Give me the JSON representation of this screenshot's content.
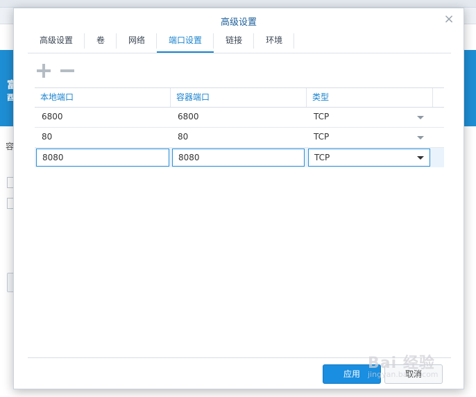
{
  "dialog": {
    "title": "高级设置",
    "close_glyph": "×"
  },
  "tabs": [
    {
      "label": "高级设置",
      "active": false
    },
    {
      "label": "卷",
      "active": false
    },
    {
      "label": "网络",
      "active": false
    },
    {
      "label": "端口设置",
      "active": true
    },
    {
      "label": "链接",
      "active": false
    },
    {
      "label": "环境",
      "active": false
    }
  ],
  "toolbar": {
    "add_icon": "plus-icon",
    "remove_icon": "minus-icon"
  },
  "table": {
    "columns": [
      "本地端口",
      "容器端口",
      "类型"
    ],
    "rows": [
      {
        "local": "6800",
        "container": "6800",
        "type": "TCP"
      },
      {
        "local": "80",
        "container": "80",
        "type": "TCP"
      },
      {
        "local": "8080",
        "container": "8080",
        "type": "TCP",
        "editing": true
      }
    ]
  },
  "buttons": {
    "apply": "应用",
    "cancel": "取消"
  },
  "background": {
    "glyph_a": "富",
    "glyph_b": "酉",
    "glyph_c": "容"
  },
  "watermark": {
    "main": "Bai 经验",
    "sub": "jingyan.baidu.com"
  },
  "colors": {
    "accent": "#1b84cf",
    "primary_button": "#1a8ee0",
    "background_band": "#1e8ed4"
  }
}
